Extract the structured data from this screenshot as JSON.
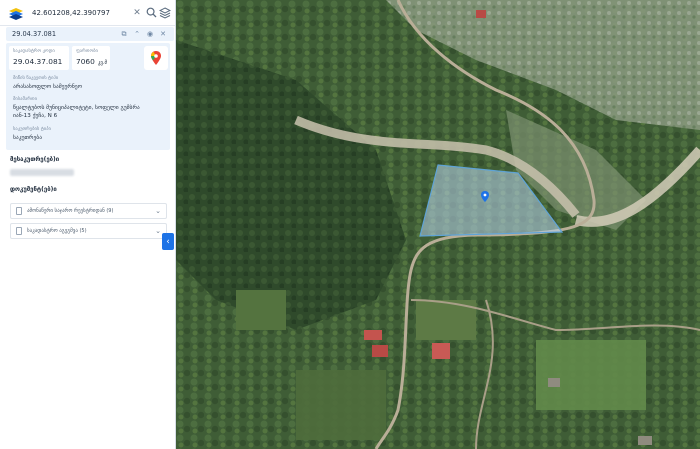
{
  "search": {
    "value": "42.601208,42.390797",
    "placeholder": ""
  },
  "card": {
    "cadastral_code": "29.04.37.081",
    "chips": [
      {
        "label": "საკადასტრო კოდი",
        "value": "29.04.37.081",
        "unit": ""
      },
      {
        "label": "ფართობი",
        "value": "7060",
        "unit": "კვ.მ"
      }
    ],
    "fields": [
      {
        "label": "მიწის ნაკვეთის ტიპი",
        "value": "არასასოფლო სამეურნეო"
      },
      {
        "label": "მისამართი",
        "value": "წყალტუბოს მუნიციპალიტეტი, სოფელი გუმბრა\nიან-13 ქუჩა, N 6"
      },
      {
        "label": "საკუთრების ტიპი",
        "value": "საკუთრება"
      }
    ]
  },
  "sections": {
    "owners_title": "მესაკუთრე(ებ)ი",
    "docs_title": "დოკუმენტ(ებ)ი",
    "accordions": [
      {
        "label": "ამონაწერი საჯარო რეესტრიდან (9)"
      },
      {
        "label": "საკადასტრო აგეგმვა (5)"
      }
    ]
  },
  "colors": {
    "accent": "#1e73e6",
    "card_bg": "#eaf2fb",
    "parcel_fill": "#b9d6ee"
  },
  "icons": {
    "logo": "georgia-napr-logo-icon",
    "clear": "close-icon",
    "search": "search-icon",
    "layers": "layers-icon",
    "collapse": "chevron-left-icon",
    "pin": "map-pin-icon"
  }
}
